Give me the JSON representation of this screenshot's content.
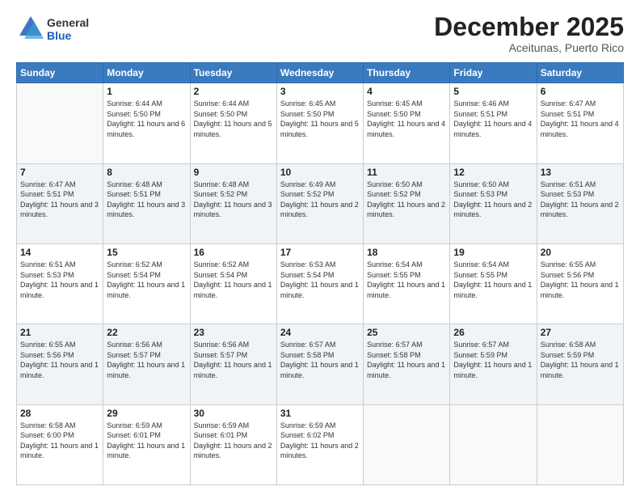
{
  "header": {
    "logo_general": "General",
    "logo_blue": "Blue",
    "month_title": "December 2025",
    "location": "Aceitunas, Puerto Rico"
  },
  "days_of_week": [
    "Sunday",
    "Monday",
    "Tuesday",
    "Wednesday",
    "Thursday",
    "Friday",
    "Saturday"
  ],
  "weeks": [
    [
      {
        "day": "",
        "sunrise": "",
        "sunset": "",
        "daylight": ""
      },
      {
        "day": "1",
        "sunrise": "Sunrise: 6:44 AM",
        "sunset": "Sunset: 5:50 PM",
        "daylight": "Daylight: 11 hours and 6 minutes."
      },
      {
        "day": "2",
        "sunrise": "Sunrise: 6:44 AM",
        "sunset": "Sunset: 5:50 PM",
        "daylight": "Daylight: 11 hours and 5 minutes."
      },
      {
        "day": "3",
        "sunrise": "Sunrise: 6:45 AM",
        "sunset": "Sunset: 5:50 PM",
        "daylight": "Daylight: 11 hours and 5 minutes."
      },
      {
        "day": "4",
        "sunrise": "Sunrise: 6:45 AM",
        "sunset": "Sunset: 5:50 PM",
        "daylight": "Daylight: 11 hours and 4 minutes."
      },
      {
        "day": "5",
        "sunrise": "Sunrise: 6:46 AM",
        "sunset": "Sunset: 5:51 PM",
        "daylight": "Daylight: 11 hours and 4 minutes."
      },
      {
        "day": "6",
        "sunrise": "Sunrise: 6:47 AM",
        "sunset": "Sunset: 5:51 PM",
        "daylight": "Daylight: 11 hours and 4 minutes."
      }
    ],
    [
      {
        "day": "7",
        "sunrise": "Sunrise: 6:47 AM",
        "sunset": "Sunset: 5:51 PM",
        "daylight": "Daylight: 11 hours and 3 minutes."
      },
      {
        "day": "8",
        "sunrise": "Sunrise: 6:48 AM",
        "sunset": "Sunset: 5:51 PM",
        "daylight": "Daylight: 11 hours and 3 minutes."
      },
      {
        "day": "9",
        "sunrise": "Sunrise: 6:48 AM",
        "sunset": "Sunset: 5:52 PM",
        "daylight": "Daylight: 11 hours and 3 minutes."
      },
      {
        "day": "10",
        "sunrise": "Sunrise: 6:49 AM",
        "sunset": "Sunset: 5:52 PM",
        "daylight": "Daylight: 11 hours and 2 minutes."
      },
      {
        "day": "11",
        "sunrise": "Sunrise: 6:50 AM",
        "sunset": "Sunset: 5:52 PM",
        "daylight": "Daylight: 11 hours and 2 minutes."
      },
      {
        "day": "12",
        "sunrise": "Sunrise: 6:50 AM",
        "sunset": "Sunset: 5:53 PM",
        "daylight": "Daylight: 11 hours and 2 minutes."
      },
      {
        "day": "13",
        "sunrise": "Sunrise: 6:51 AM",
        "sunset": "Sunset: 5:53 PM",
        "daylight": "Daylight: 11 hours and 2 minutes."
      }
    ],
    [
      {
        "day": "14",
        "sunrise": "Sunrise: 6:51 AM",
        "sunset": "Sunset: 5:53 PM",
        "daylight": "Daylight: 11 hours and 1 minute."
      },
      {
        "day": "15",
        "sunrise": "Sunrise: 6:52 AM",
        "sunset": "Sunset: 5:54 PM",
        "daylight": "Daylight: 11 hours and 1 minute."
      },
      {
        "day": "16",
        "sunrise": "Sunrise: 6:52 AM",
        "sunset": "Sunset: 5:54 PM",
        "daylight": "Daylight: 11 hours and 1 minute."
      },
      {
        "day": "17",
        "sunrise": "Sunrise: 6:53 AM",
        "sunset": "Sunset: 5:54 PM",
        "daylight": "Daylight: 11 hours and 1 minute."
      },
      {
        "day": "18",
        "sunrise": "Sunrise: 6:54 AM",
        "sunset": "Sunset: 5:55 PM",
        "daylight": "Daylight: 11 hours and 1 minute."
      },
      {
        "day": "19",
        "sunrise": "Sunrise: 6:54 AM",
        "sunset": "Sunset: 5:55 PM",
        "daylight": "Daylight: 11 hours and 1 minute."
      },
      {
        "day": "20",
        "sunrise": "Sunrise: 6:55 AM",
        "sunset": "Sunset: 5:56 PM",
        "daylight": "Daylight: 11 hours and 1 minute."
      }
    ],
    [
      {
        "day": "21",
        "sunrise": "Sunrise: 6:55 AM",
        "sunset": "Sunset: 5:56 PM",
        "daylight": "Daylight: 11 hours and 1 minute."
      },
      {
        "day": "22",
        "sunrise": "Sunrise: 6:56 AM",
        "sunset": "Sunset: 5:57 PM",
        "daylight": "Daylight: 11 hours and 1 minute."
      },
      {
        "day": "23",
        "sunrise": "Sunrise: 6:56 AM",
        "sunset": "Sunset: 5:57 PM",
        "daylight": "Daylight: 11 hours and 1 minute."
      },
      {
        "day": "24",
        "sunrise": "Sunrise: 6:57 AM",
        "sunset": "Sunset: 5:58 PM",
        "daylight": "Daylight: 11 hours and 1 minute."
      },
      {
        "day": "25",
        "sunrise": "Sunrise: 6:57 AM",
        "sunset": "Sunset: 5:58 PM",
        "daylight": "Daylight: 11 hours and 1 minute."
      },
      {
        "day": "26",
        "sunrise": "Sunrise: 6:57 AM",
        "sunset": "Sunset: 5:59 PM",
        "daylight": "Daylight: 11 hours and 1 minute."
      },
      {
        "day": "27",
        "sunrise": "Sunrise: 6:58 AM",
        "sunset": "Sunset: 5:59 PM",
        "daylight": "Daylight: 11 hours and 1 minute."
      }
    ],
    [
      {
        "day": "28",
        "sunrise": "Sunrise: 6:58 AM",
        "sunset": "Sunset: 6:00 PM",
        "daylight": "Daylight: 11 hours and 1 minute."
      },
      {
        "day": "29",
        "sunrise": "Sunrise: 6:59 AM",
        "sunset": "Sunset: 6:01 PM",
        "daylight": "Daylight: 11 hours and 1 minute."
      },
      {
        "day": "30",
        "sunrise": "Sunrise: 6:59 AM",
        "sunset": "Sunset: 6:01 PM",
        "daylight": "Daylight: 11 hours and 2 minutes."
      },
      {
        "day": "31",
        "sunrise": "Sunrise: 6:59 AM",
        "sunset": "Sunset: 6:02 PM",
        "daylight": "Daylight: 11 hours and 2 minutes."
      },
      {
        "day": "",
        "sunrise": "",
        "sunset": "",
        "daylight": ""
      },
      {
        "day": "",
        "sunrise": "",
        "sunset": "",
        "daylight": ""
      },
      {
        "day": "",
        "sunrise": "",
        "sunset": "",
        "daylight": ""
      }
    ]
  ]
}
